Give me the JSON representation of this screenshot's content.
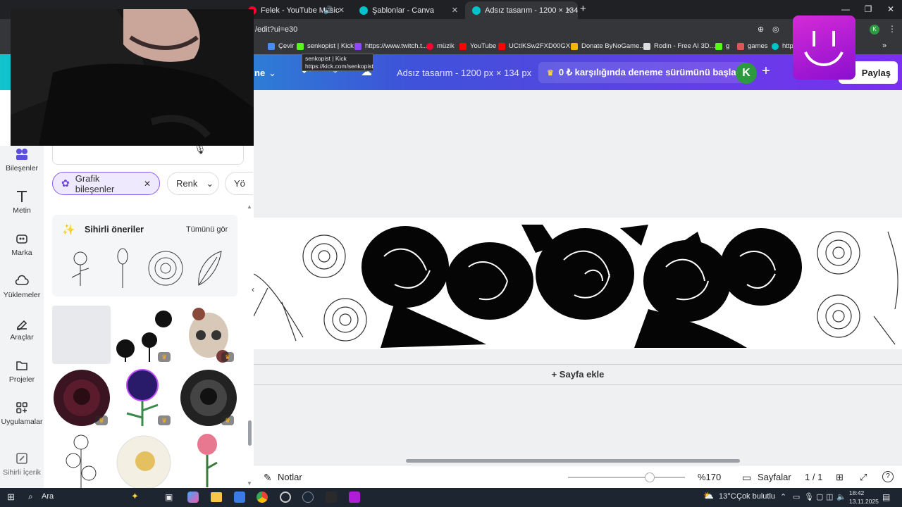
{
  "browser": {
    "tabs": [
      {
        "title": "Felek - YouTube Music",
        "favicon_color": "#ff0033"
      },
      {
        "title": "Şablonlar - Canva",
        "favicon_color": "#00c4cc"
      },
      {
        "title": "Adsız tasarım - 1200 × 134 px",
        "favicon_color": "#00c4cc",
        "active": true
      }
    ],
    "url": "/edit?ui=e30",
    "bookmarks": [
      {
        "label": "Çevir",
        "color": "#4a8af4"
      },
      {
        "label": "senkopist | Kick",
        "color": "#53fc18"
      },
      {
        "label": "https://www.twitch.t...",
        "color": "#9146ff"
      },
      {
        "label": "müzik",
        "color": "#ff0033"
      },
      {
        "label": "YouTube",
        "color": "#ff0000"
      },
      {
        "label": "UCtIKSw2FXD00GX...",
        "color": "#ff0000"
      },
      {
        "label": "Donate ByNoGame...",
        "color": "#f7b500"
      },
      {
        "label": "Rodin - Free AI 3D...",
        "color": "#dddddd"
      },
      {
        "label": "g",
        "color": "#53fc18"
      },
      {
        "label": "games",
        "color": "#e05555"
      },
      {
        "label": "http",
        "color": "#00c4cc"
      }
    ],
    "tooltip": {
      "line1": "senkopist | Kick",
      "line2": "https://kick.com/senkopist"
    },
    "window_controls": [
      "—",
      "❐",
      "✕"
    ]
  },
  "header": {
    "menu_label": "ne",
    "doc_title": "Adsız tasarım - 1200 px × 134 px",
    "trial_label": "0 ₺ karşılığında deneme sürümünü başlat",
    "avatar_letter": "K",
    "share_label": "Paylaş"
  },
  "leftnav": {
    "items": [
      {
        "label": "Bileşenler",
        "icon": "elements-icon"
      },
      {
        "label": "Metin",
        "icon": "text-icon"
      },
      {
        "label": "Marka",
        "icon": "brand-icon"
      },
      {
        "label": "Yüklemeler",
        "icon": "uploads-icon"
      },
      {
        "label": "Araçlar",
        "icon": "tools-icon"
      },
      {
        "label": "Projeler",
        "icon": "folder-icon"
      },
      {
        "label": "Uygulamalar",
        "icon": "apps-icon"
      },
      {
        "label": "Sihirli İçerik",
        "icon": "magic-media-icon"
      }
    ]
  },
  "panel": {
    "chips": {
      "active": "Grafik bileşenler",
      "color": "Renk",
      "more": "Yö"
    },
    "magic": {
      "title": "Sihirli öneriler",
      "see_all": "Tümünü gör"
    }
  },
  "canvas": {
    "add_page": "+ Sayfa ekle"
  },
  "bottombar": {
    "notes": "Notlar",
    "zoom": "%170",
    "zoom_level": 0.7,
    "pages": "Sayfalar",
    "page_count": "1 / 1"
  },
  "taskbar": {
    "search": "Ara",
    "weather": "13°C",
    "weather_text": "Çok bulutlu",
    "time": "18:42",
    "date": "13.11.2025"
  },
  "colors": {
    "accent": "#7b2ff0",
    "chip_active": "#8b5cf6",
    "header_start": "#11c3cd"
  }
}
